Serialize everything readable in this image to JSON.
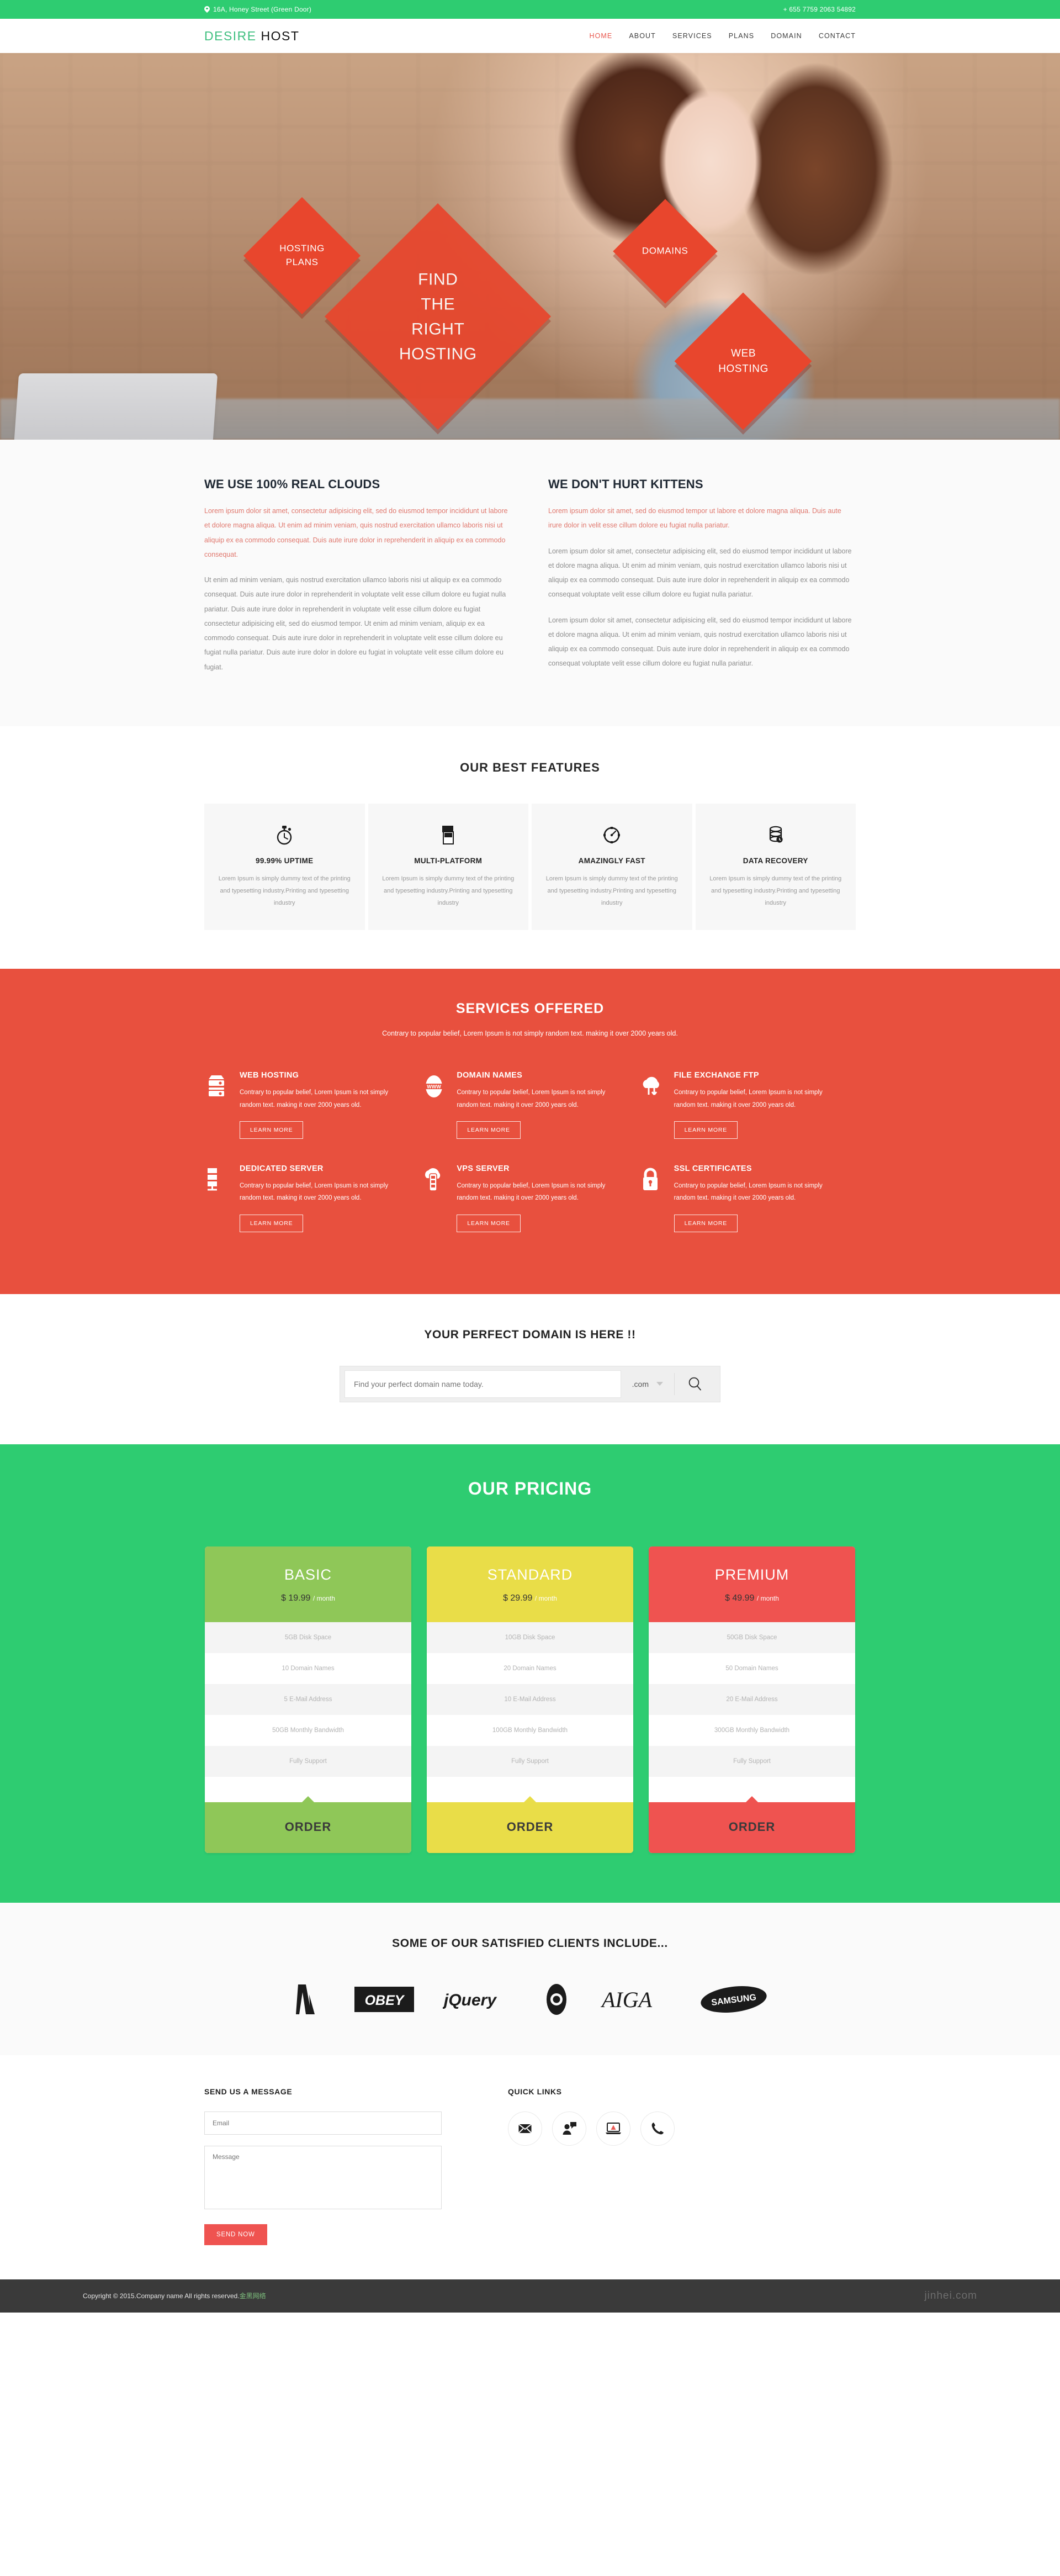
{
  "topbar": {
    "address": "16A, Honey Street (Green Door)",
    "phone": "+ 655 7759 2063 54892",
    "bg": "#2ecc71"
  },
  "header": {
    "logo_first": "DESIRE",
    "logo_second": "HOST",
    "nav": [
      {
        "label": "HOME",
        "active": true
      },
      {
        "label": "ABOUT",
        "active": false
      },
      {
        "label": "SERVICES",
        "active": false
      },
      {
        "label": "PLANS",
        "active": false
      },
      {
        "label": "DOMAIN",
        "active": false
      },
      {
        "label": "CONTACT",
        "active": false
      }
    ]
  },
  "banner": {
    "diamonds": [
      {
        "label": "HOSTING\nPLANS"
      },
      {
        "label": "FIND\nTHE\nRIGHT\nHOSTING"
      },
      {
        "label": "DOMAINS"
      },
      {
        "label": "WEB\nHOSTING"
      }
    ],
    "accent": "#e8462d"
  },
  "about": {
    "left": {
      "title": "WE USE 100% REAL CLOUDS",
      "p1": "Lorem ipsum dolor sit amet, consectetur adipisicing elit, sed do eiusmod tempor incididunt ut labore et dolore magna aliqua. Ut enim ad minim veniam, quis nostrud exercitation ullamco laboris nisi ut aliquip ex ea commodo consequat. Duis aute irure dolor in reprehenderit in aliquip ex ea commodo consequat.",
      "p2": "Ut enim ad minim veniam, quis nostrud exercitation ullamco laboris nisi ut aliquip ex ea commodo consequat. Duis aute irure dolor in reprehenderit in voluptate velit esse cillum dolore eu fugiat nulla pariatur. Duis aute irure dolor in reprehenderit in voluptate velit esse cillum dolore eu fugiat consectetur adipisicing elit, sed do eiusmod tempor. Ut enim ad minim veniam, aliquip ex ea commodo consequat. Duis aute irure dolor in reprehenderit in voluptate velit esse cillum dolore eu fugiat nulla pariatur. Duis aute irure dolor in dolore eu fugiat in voluptate velit esse cillum dolore eu fugiat."
    },
    "right": {
      "title": "WE DON'T HURT KITTENS",
      "p1": "Lorem ipsum dolor sit amet, sed do eiusmod tempor ut labore et dolore magna aliqua. Duis aute irure dolor in velit esse cillum dolore eu fugiat nulla pariatur.",
      "p2": "Lorem ipsum dolor sit amet, consectetur adipisicing elit, sed do eiusmod tempor incididunt ut labore et dolore magna aliqua. Ut enim ad minim veniam, quis nostrud exercitation ullamco laboris nisi ut aliquip ex ea commodo consequat. Duis aute irure dolor in reprehenderit in aliquip ex ea commodo consequat voluptate velit esse cillum dolore eu fugiat nulla pariatur.",
      "p3": "Lorem ipsum dolor sit amet, consectetur adipisicing elit, sed do eiusmod tempor incididunt ut labore et dolore magna aliqua. Ut enim ad minim veniam, quis nostrud exercitation ullamco laboris nisi ut aliquip ex ea commodo consequat. Duis aute irure dolor in reprehenderit in aliquip ex ea commodo consequat voluptate velit esse cillum dolore eu fugiat nulla pariatur."
    }
  },
  "features": {
    "title": "OUR BEST FEATURES",
    "items": [
      {
        "icon": "stopwatch-icon",
        "title": "99.99% UPTIME",
        "text": "Lorem Ipsum is simply dummy text of the printing and typesetting industry.Printing and typesetting industry"
      },
      {
        "icon": "multi-platform-icon",
        "title": "MULTI-PLATFORM",
        "text": "Lorem Ipsum is simply dummy text of the printing and typesetting industry.Printing and typesetting industry"
      },
      {
        "icon": "speedometer-icon",
        "title": "AMAZINGLY FAST",
        "text": "Lorem Ipsum is simply dummy text of the printing and typesetting industry.Printing and typesetting industry"
      },
      {
        "icon": "data-recovery-icon",
        "title": "DATA RECOVERY",
        "text": "Lorem Ipsum is simply dummy text of the printing and typesetting industry.Printing and typesetting industry"
      }
    ]
  },
  "services": {
    "title": "SERVICES OFFERED",
    "lead": "Contrary to popular belief, Lorem Ipsum is not simply random text. making it over 2000 years old.",
    "bg": "#e8503e",
    "items": [
      {
        "icon": "server-stack-icon",
        "title": "WEB HOSTING",
        "text": "Contrary to popular belief, Lorem Ipsum is not simply random text. making it over 2000 years old.",
        "button": "LEARN MORE"
      },
      {
        "icon": "www-globe-icon",
        "title": "DOMAIN NAMES",
        "text": "Contrary to popular belief, Lorem Ipsum is not simply random text. making it over 2000 years old.",
        "button": "LEARN MORE"
      },
      {
        "icon": "cloud-transfer-icon",
        "title": "FILE EXCHANGE FTP",
        "text": "Contrary to popular belief, Lorem Ipsum is not simply random text. making it over 2000 years old.",
        "button": "LEARN MORE"
      },
      {
        "icon": "rack-server-icon",
        "title": "DEDICATED SERVER",
        "text": "Contrary to popular belief, Lorem Ipsum is not simply random text. making it over 2000 years old.",
        "button": "LEARN MORE"
      },
      {
        "icon": "cloud-vps-icon",
        "title": "VPS SERVER",
        "text": "Contrary to popular belief, Lorem Ipsum is not simply random text. making it over 2000 years old.",
        "button": "LEARN MORE"
      },
      {
        "icon": "padlock-icon",
        "title": "SSL CERTIFICATES",
        "text": "Contrary to popular belief, Lorem Ipsum is not simply random text. making it over 2000 years old.",
        "button": "LEARN MORE"
      }
    ]
  },
  "domain_search": {
    "title": "YOUR PERFECT DOMAIN IS HERE !!",
    "placeholder": "Find your perfect domain name today.",
    "value": "",
    "tld": ".com",
    "search_icon": "magnifier-icon"
  },
  "pricing": {
    "title": "OUR PRICING",
    "bg": "#2ecc71",
    "plans": [
      {
        "name": "BASIC",
        "price": "$ 19.99",
        "per": "/ month",
        "color": "#8fc758",
        "features": [
          "5GB Disk Space",
          "10 Domain Names",
          "5 E-Mail Address",
          "50GB Monthly Bandwidth",
          "Fully Support"
        ],
        "button": "ORDER"
      },
      {
        "name": "STANDARD",
        "price": "$ 29.99",
        "per": "/ month",
        "color": "#e9dd48",
        "features": [
          "10GB Disk Space",
          "20 Domain Names",
          "10 E-Mail Address",
          "100GB Monthly Bandwidth",
          "Fully Support"
        ],
        "button": "ORDER"
      },
      {
        "name": "PREMIUM",
        "price": "$ 49.99",
        "per": "/ month",
        "color": "#ef5350",
        "features": [
          "50GB Disk Space",
          "50 Domain Names",
          "20 E-Mail Address",
          "300GB Monthly Bandwidth",
          "Fully Support"
        ],
        "button": "ORDER"
      }
    ]
  },
  "clients": {
    "title": "SOME OF OUR SATISFIED CLIENTS INCLUDE...",
    "logos": [
      "A",
      "OBEY",
      "jQuery",
      "CBS",
      "AIGA",
      "SAMSUNG"
    ]
  },
  "contact": {
    "form_title": "SEND US A MESSAGE",
    "email_placeholder": "Email",
    "email_value": "",
    "message_placeholder": "Message",
    "message_value": "",
    "send_label": "SEND NOW",
    "links_title": "QUICK LINKS",
    "links": [
      {
        "icon": "envelope-icon"
      },
      {
        "icon": "support-chat-icon"
      },
      {
        "icon": "laptop-alert-icon"
      },
      {
        "icon": "phone-icon"
      }
    ]
  },
  "footer": {
    "copyright": "Copyright © 2015.Company name All rights reserved.",
    "company_cn": "金黑网络",
    "brand": "jinhei.com"
  }
}
